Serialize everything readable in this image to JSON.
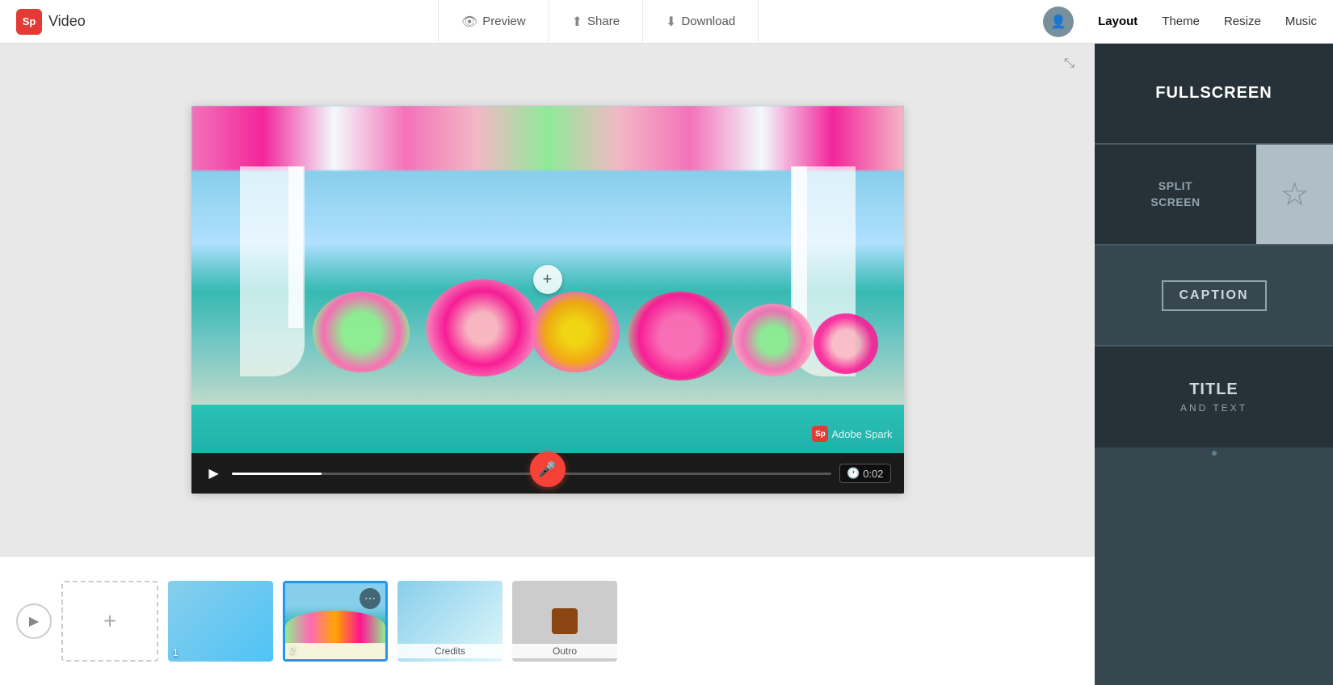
{
  "app": {
    "logo_initials": "Sp",
    "logo_name": "Video"
  },
  "header": {
    "nav_items": [
      {
        "id": "preview",
        "label": "Preview",
        "icon": "👁"
      },
      {
        "id": "share",
        "label": "Share",
        "icon": "⬆"
      },
      {
        "id": "download",
        "label": "Download",
        "icon": "⬇"
      }
    ],
    "right_nav": [
      {
        "id": "layout",
        "label": "Layout",
        "active": true
      },
      {
        "id": "theme",
        "label": "Theme",
        "active": false
      },
      {
        "id": "resize",
        "label": "Resize",
        "active": false
      },
      {
        "id": "music",
        "label": "Music",
        "active": false
      }
    ]
  },
  "video": {
    "watermark": "Adobe Spark",
    "time_display": "0:02",
    "plus_label": "+"
  },
  "timeline": {
    "play_icon": "▶",
    "add_icon": "+",
    "slides": [
      {
        "id": "slide1",
        "number": "1",
        "type": "blue"
      },
      {
        "id": "slide2",
        "number": "2",
        "type": "floral",
        "active": true
      },
      {
        "id": "credits",
        "label": "Credits",
        "type": "credits"
      },
      {
        "id": "outro",
        "label": "Outro",
        "type": "outro"
      }
    ]
  },
  "right_panel": {
    "layouts": [
      {
        "id": "fullscreen",
        "label": "FULLSCREEN",
        "type": "fullscreen"
      },
      {
        "id": "split-screen",
        "label1": "SPLIT",
        "label2": "SCREEN",
        "type": "split"
      },
      {
        "id": "caption",
        "label": "CAPTION",
        "type": "caption"
      },
      {
        "id": "title-text",
        "label1": "TITLE",
        "label2": "AND TEXT",
        "type": "title"
      }
    ]
  }
}
